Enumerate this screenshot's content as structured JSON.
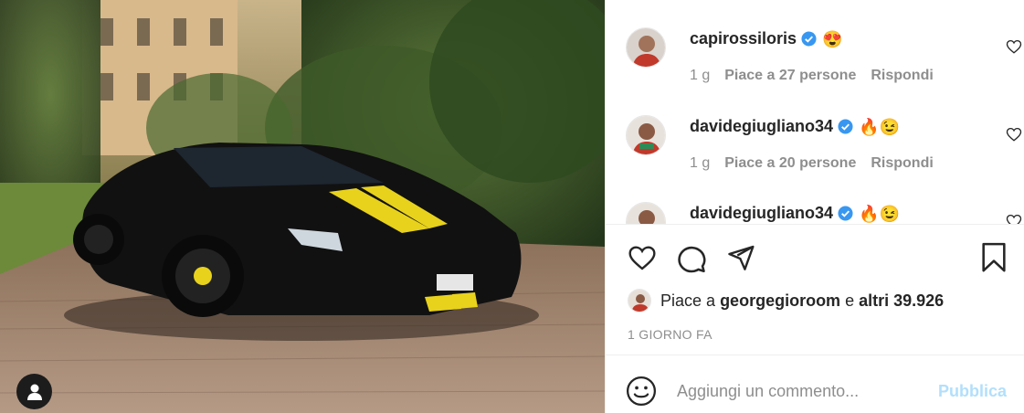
{
  "photo": {
    "alt": "post-photo-car",
    "tag_icon": "user-tag-icon"
  },
  "comments": [
    {
      "username": "capirossiloris",
      "emoji": "😍",
      "age": "1 g",
      "likes": "Piace a 27 persone",
      "reply": "Rispondi"
    },
    {
      "username": "davidegiugliano34",
      "emoji": "🔥😉",
      "age": "1 g",
      "likes": "Piace a 20 persone",
      "reply": "Rispondi"
    },
    {
      "username": "davidegiugliano34",
      "emoji": "🔥😉",
      "age": "",
      "likes": "",
      "reply": ""
    }
  ],
  "actions": {
    "like_icon": "heart-icon",
    "comment_icon": "comment-bubble-icon",
    "share_icon": "paper-plane-icon",
    "save_icon": "bookmark-icon"
  },
  "likes_summary": {
    "prefix": "Piace a",
    "user": "georgegioroom",
    "connector": "e",
    "others": "altri 39.926"
  },
  "timestamp": "1 GIORNO FA",
  "comment_box": {
    "placeholder": "Aggiungi un commento...",
    "publish_label": "Pubblica"
  },
  "colors": {
    "verified": "#3897f0",
    "publish_disabled": "#b2dffc",
    "meta_gray": "#8e8e8e",
    "text": "#262626"
  }
}
